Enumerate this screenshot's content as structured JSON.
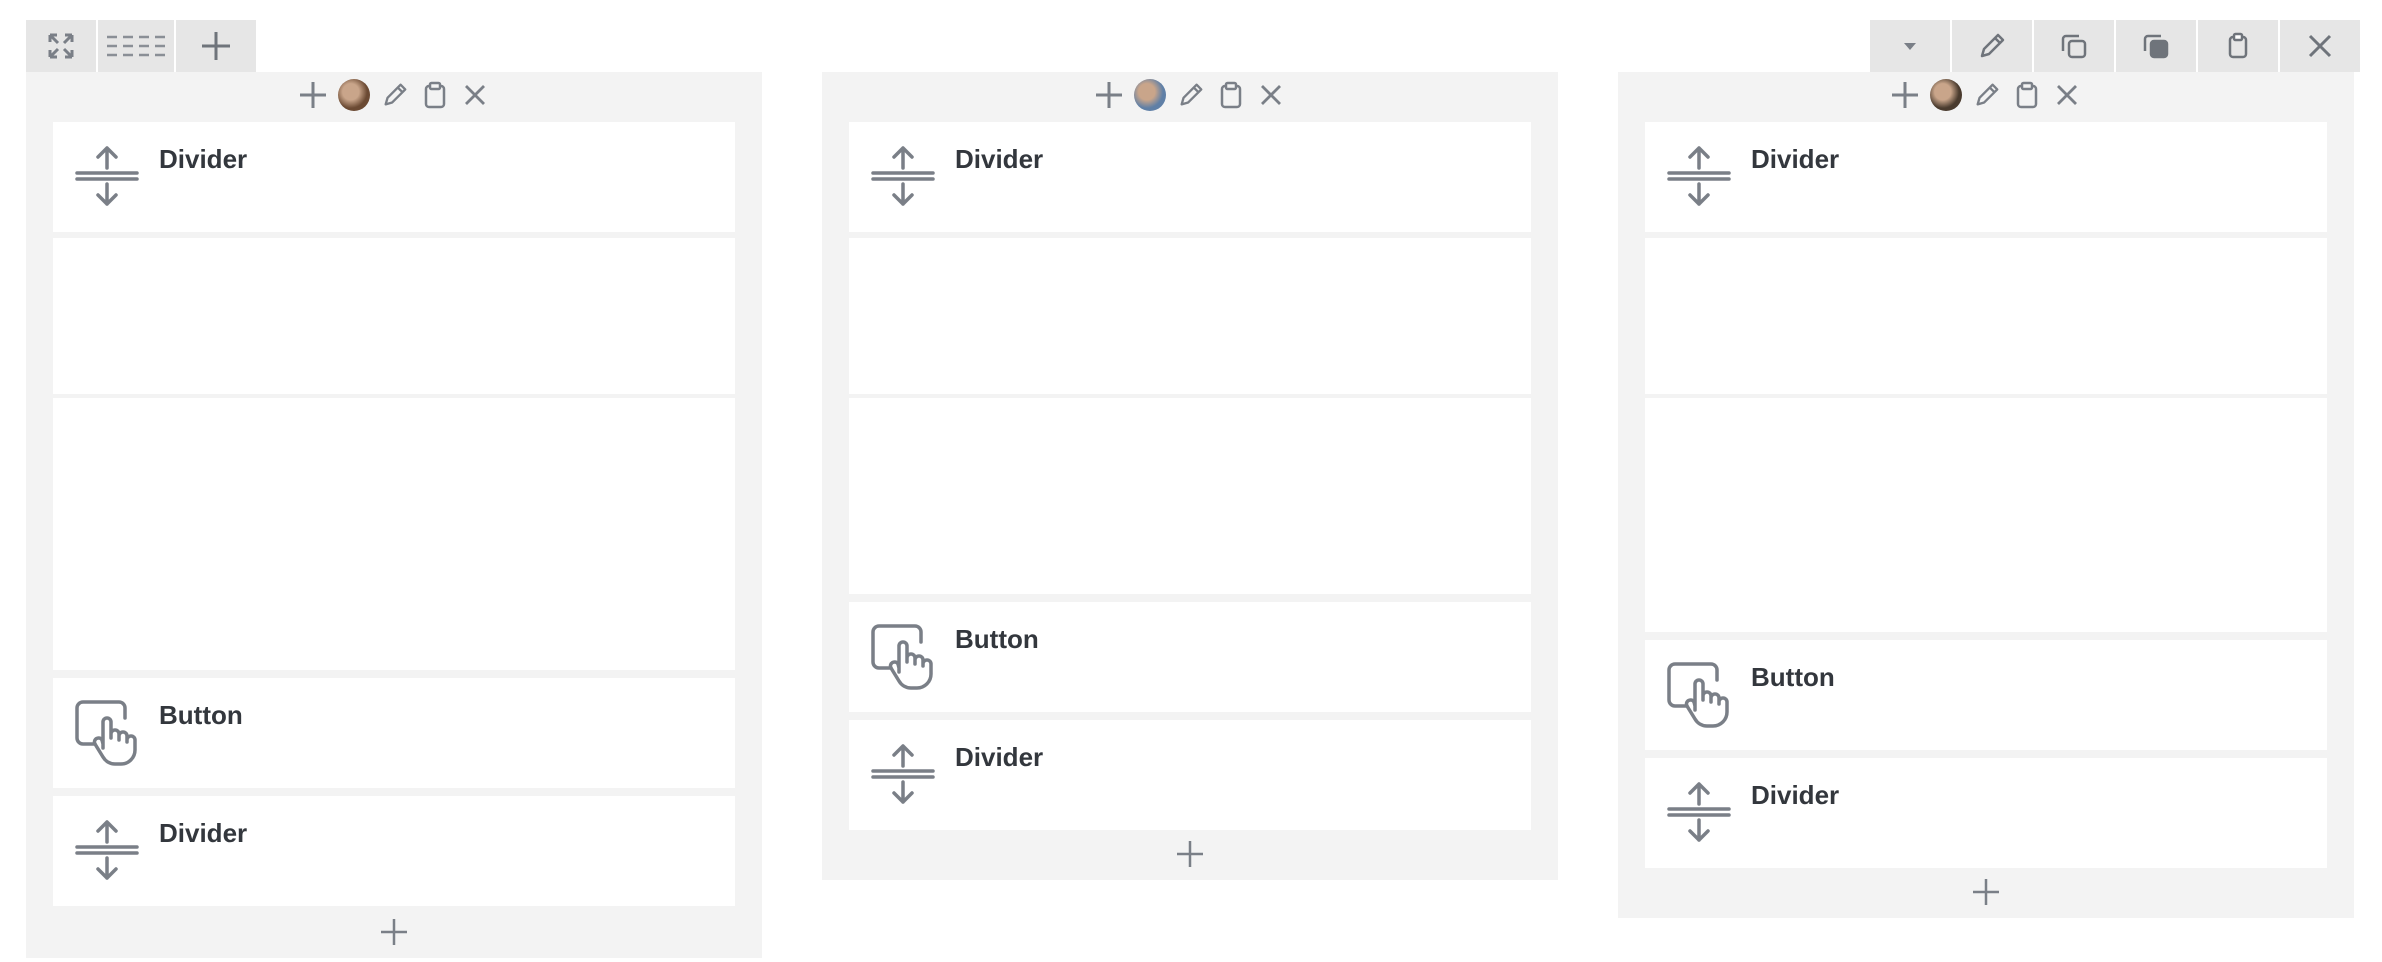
{
  "toolbar": {
    "left": [
      {
        "name": "expand-icon"
      },
      {
        "name": "list-layout-icon"
      },
      {
        "name": "plus-icon"
      }
    ],
    "right": [
      {
        "name": "chevron-down-icon"
      },
      {
        "name": "pencil-icon"
      },
      {
        "name": "copy-icon"
      },
      {
        "name": "paste-icon"
      },
      {
        "name": "clipboard-icon"
      },
      {
        "name": "close-icon"
      }
    ]
  },
  "columns": [
    {
      "avatar_color": "#6b4a33",
      "items": [
        {
          "type": "divider",
          "label": "Divider"
        },
        {
          "type": "empty",
          "label": ""
        },
        {
          "type": "empty",
          "label": ""
        },
        {
          "type": "button",
          "label": "Button"
        },
        {
          "type": "divider",
          "label": "Divider"
        }
      ]
    },
    {
      "avatar_color": "#5f7fa6",
      "items": [
        {
          "type": "divider",
          "label": "Divider"
        },
        {
          "type": "empty",
          "label": ""
        },
        {
          "type": "empty",
          "label": ""
        },
        {
          "type": "button",
          "label": "Button"
        },
        {
          "type": "divider",
          "label": "Divider"
        }
      ]
    },
    {
      "avatar_color": "#4a3b2e",
      "items": [
        {
          "type": "divider",
          "label": "Divider"
        },
        {
          "type": "empty",
          "label": ""
        },
        {
          "type": "empty",
          "label": ""
        },
        {
          "type": "button",
          "label": "Button"
        },
        {
          "type": "divider",
          "label": "Divider"
        }
      ]
    }
  ],
  "colors": {
    "icon": "#7a7f87",
    "panel_bg": "#f3f3f3",
    "toolbar_bg": "#e6e6e6"
  }
}
